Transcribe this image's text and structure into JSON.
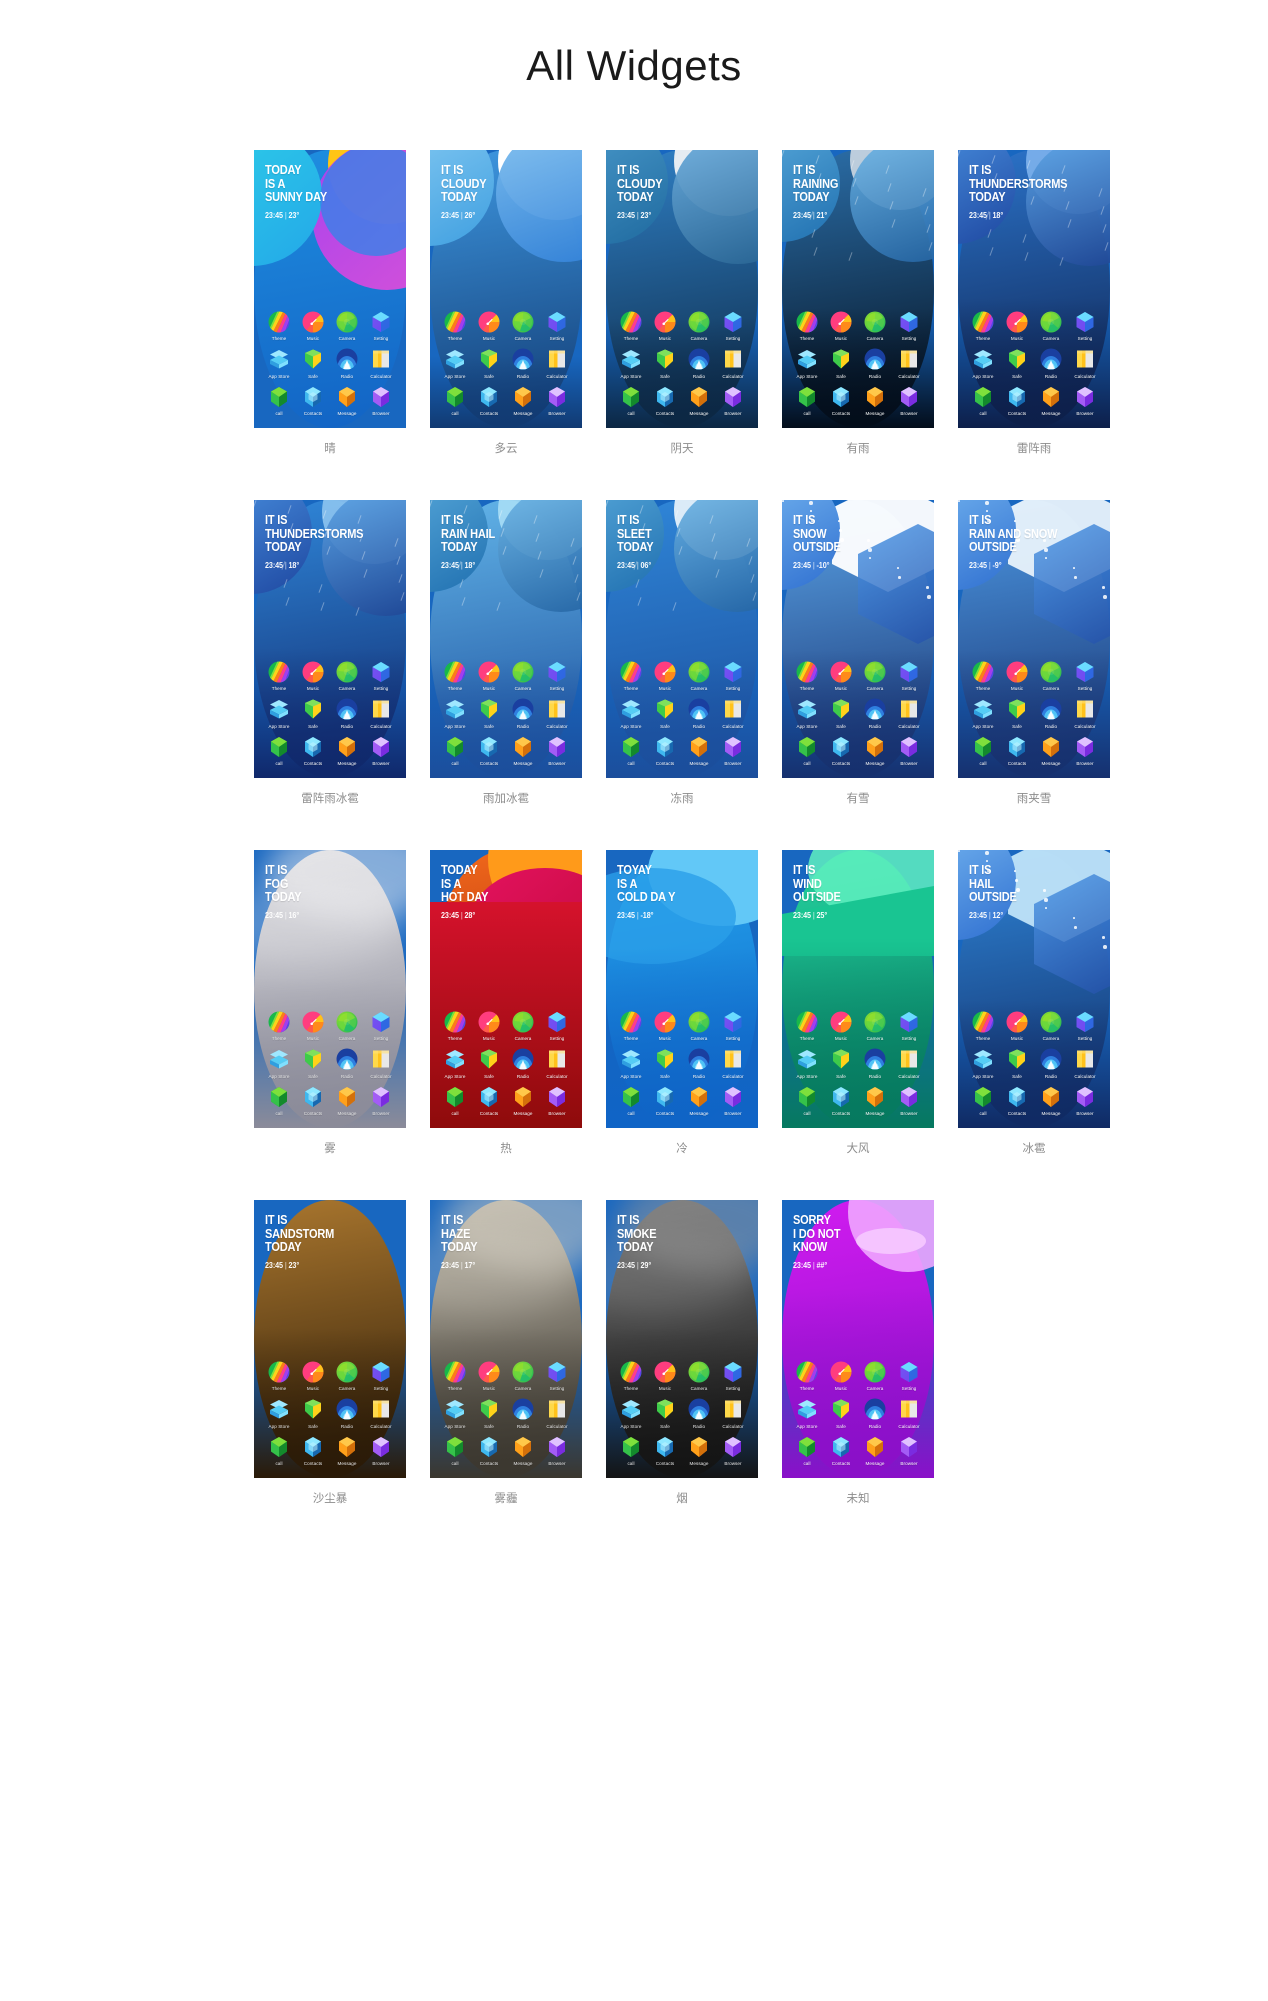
{
  "page": {
    "title": "All Widgets",
    "background": "#ffffff",
    "title_color": "#1a1a1a"
  },
  "apps": [
    {
      "label": "Theme",
      "name": "theme-icon",
      "shape": "circle-rainbow"
    },
    {
      "label": "Music",
      "name": "music-icon",
      "shape": "circle-note"
    },
    {
      "label": "Camera",
      "name": "camera-icon",
      "shape": "circle-shutter"
    },
    {
      "label": "Setting",
      "name": "settings-icon",
      "shape": "hex-cube-blue"
    },
    {
      "label": "App Store",
      "name": "app-store-icon",
      "shape": "box-cyan"
    },
    {
      "label": "Safe",
      "name": "safe-icon",
      "shape": "shield-green"
    },
    {
      "label": "Radio",
      "name": "radio-icon",
      "shape": "circle-waves"
    },
    {
      "label": "Calculator",
      "name": "calculator-icon",
      "shape": "square-yellow"
    },
    {
      "label": "call",
      "name": "call-icon",
      "shape": "gem-green"
    },
    {
      "label": "Contacts",
      "name": "contacts-icon",
      "shape": "gem-cyan"
    },
    {
      "label": "Message",
      "name": "message-icon",
      "shape": "gem-orange"
    },
    {
      "label": "Browser",
      "name": "browser-icon",
      "shape": "gem-purple"
    }
  ],
  "widgets": [
    {
      "id": "sunny",
      "headline": [
        "TODAY",
        "IS A",
        "SUNNY DAY"
      ],
      "time": "23:45",
      "temp": "23°",
      "caption": "晴",
      "bg_from": "#1f8ee0",
      "bg_to": "#1263c4",
      "accent": "#ffc515",
      "scene": "sun"
    },
    {
      "id": "cloudy",
      "headline": [
        "IT IS",
        "CLOUDY",
        "TODAY"
      ],
      "time": "23:45",
      "temp": "26°",
      "caption": "多云",
      "bg_from": "#3e97e0",
      "bg_to": "#113a72",
      "accent": "#f2f6fa",
      "scene": "cloud"
    },
    {
      "id": "overcast",
      "headline": [
        "IT IS",
        "CLOUDY",
        "TODAY"
      ],
      "time": "23:45",
      "temp": "23°",
      "caption": "阴天",
      "bg_from": "#2f7fc4",
      "bg_to": "#0c2743",
      "accent": "#dfe6ec",
      "scene": "overcast"
    },
    {
      "id": "rain",
      "headline": [
        "IT IS",
        "RAINING",
        "TODAY"
      ],
      "time": "23:45",
      "temp": "21°",
      "caption": "有雨",
      "bg_from": "#2b6ea8",
      "bg_to": "#030d1a",
      "accent": "#c9d6e2",
      "scene": "rain"
    },
    {
      "id": "thunderstorm",
      "headline": [
        "IT IS",
        "THUNDERSTORMS",
        "TODAY"
      ],
      "time": "23:45",
      "temp": "18°",
      "caption": "雷阵雨",
      "bg_from": "#2b73c9",
      "bg_to": "#0d1f4a",
      "accent": "#7fb4ee",
      "scene": "storm"
    },
    {
      "id": "thunderstorm-hail",
      "headline": [
        "IT IS",
        "THUNDERSTORMS",
        "TODAY"
      ],
      "time": "23:45",
      "temp": "18°",
      "caption": "雷阵雨冰雹",
      "bg_from": "#2f86d8",
      "bg_to": "#10286b",
      "accent": "#8fc6f0",
      "scene": "storm-hail"
    },
    {
      "id": "rain-hail",
      "headline": [
        "IT IS",
        "RAIN HAIL",
        "TODAY"
      ],
      "time": "23:45",
      "temp": "18°",
      "caption": "雨加冰雹",
      "bg_from": "#62b4e8",
      "bg_to": "#1b4e9c",
      "accent": "#a6dcf5",
      "scene": "rain-hail"
    },
    {
      "id": "sleet",
      "headline": [
        "IT IS",
        "SLEET",
        "TODAY"
      ],
      "time": "23:45",
      "temp": "06°",
      "caption": "冻雨",
      "bg_from": "#2f86d8",
      "bg_to": "#1b4e9c",
      "accent": "#eaf4fb",
      "scene": "sleet"
    },
    {
      "id": "snow",
      "headline": [
        "IT IS",
        "SNOW",
        "OUTSIDE"
      ],
      "time": "23:45",
      "temp": "-10°",
      "caption": "有雪",
      "bg_from": "#5ba5e8",
      "bg_to": "#16306e",
      "accent": "#ffffff",
      "scene": "snow"
    },
    {
      "id": "rain-snow",
      "headline": [
        "IT IS",
        "RAIN AND SNOW",
        "OUTSIDE"
      ],
      "time": "23:45",
      "temp": "-9°",
      "caption": "雨夹雪",
      "bg_from": "#4e9ae4",
      "bg_to": "#16306e",
      "accent": "#e8f2fb",
      "scene": "rain-snow"
    },
    {
      "id": "fog",
      "headline": [
        "IT IS",
        "FOG",
        "TODAY"
      ],
      "time": "23:45",
      "temp": "16°",
      "caption": "雾",
      "bg_from": "#d9d9dd",
      "bg_to": "#8b8b99",
      "accent": "#f2f2f4",
      "scene": "fog"
    },
    {
      "id": "hot",
      "headline": [
        "TODAY",
        "IS A",
        "HOT DAY"
      ],
      "time": "23:45",
      "temp": "28°",
      "caption": "热",
      "bg_from": "#f26a1b",
      "bg_to": "#8e0b0b",
      "accent": "#e4125f",
      "scene": "hot"
    },
    {
      "id": "cold",
      "headline": [
        "TOYAY",
        "IS A",
        "COLD DA Y"
      ],
      "time": "23:45",
      "temp": "-18°",
      "caption": "冷",
      "bg_from": "#25a6ef",
      "bg_to": "#0f64c6",
      "accent": "#62c8f7",
      "scene": "cold"
    },
    {
      "id": "wind",
      "headline": [
        "IT IS",
        "WIND",
        "OUTSIDE"
      ],
      "time": "23:45",
      "temp": "25°",
      "caption": "大风",
      "bg_from": "#25d4a0",
      "bg_to": "#06795f",
      "accent": "#5ff0c0",
      "scene": "wind"
    },
    {
      "id": "hail",
      "headline": [
        "IT IS",
        "HAIL",
        "OUTSIDE"
      ],
      "time": "23:45",
      "temp": "12°",
      "caption": "冰雹",
      "bg_from": "#2f86d8",
      "bg_to": "#102a63",
      "accent": "#bfe3f8",
      "scene": "hail"
    },
    {
      "id": "sandstorm",
      "headline": [
        "IT IS",
        "SANDSTORM",
        "TODAY"
      ],
      "time": "23:45",
      "temp": "23°",
      "caption": "沙尘暴",
      "bg_from": "#a9762e",
      "bg_to": "#2a1a07",
      "accent": "#d9a martian",
      "scene": "sand"
    },
    {
      "id": "haze",
      "headline": [
        "IT IS",
        "HAZE",
        "TODAY"
      ],
      "time": "23:45",
      "temp": "17°",
      "caption": "雾霾",
      "bg_from": "#b8b2a4",
      "bg_to": "#3b372f",
      "accent": "#d8d3c7",
      "scene": "haze"
    },
    {
      "id": "smoke",
      "headline": [
        "IT IS",
        "SMOKE",
        "TODAY"
      ],
      "time": "23:45",
      "temp": "29°",
      "caption": "烟",
      "bg_from": "#6d6d6d",
      "bg_to": "#141414",
      "accent": "#9a9a9a",
      "scene": "smoke"
    },
    {
      "id": "unknown",
      "headline": [
        "SORRY",
        "I DO NOT",
        "KNOW"
      ],
      "time": "23:45",
      "temp": "##°",
      "caption": "未知",
      "bg_from": "#d11cf0",
      "bg_to": "#8a10c8",
      "accent": "#f0a6ff",
      "scene": "unknown"
    }
  ]
}
